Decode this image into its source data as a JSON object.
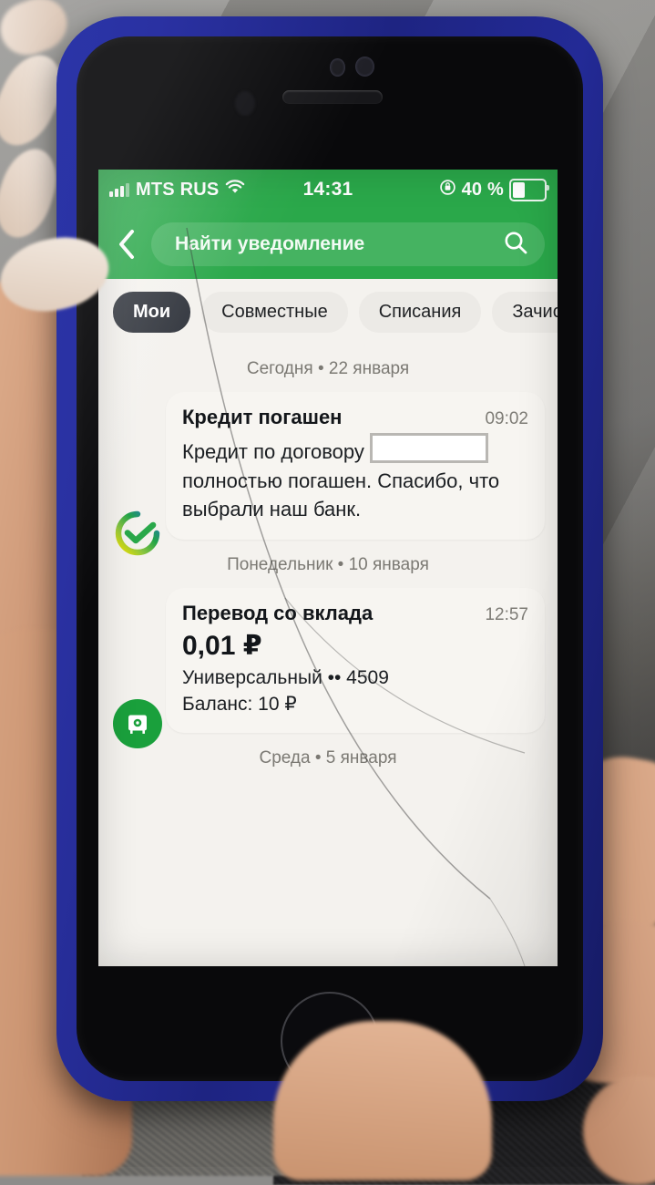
{
  "status_bar": {
    "carrier": "MTS RUS",
    "time": "14:31",
    "battery_percent": "40 %",
    "signal_icon": "signal-bars-icon",
    "wifi_icon": "wifi-icon",
    "rotation_lock_icon": "rotation-lock-icon",
    "battery_icon": "battery-icon"
  },
  "header": {
    "back_icon": "back-chevron-icon",
    "search_placeholder": "Найти уведомление",
    "search_icon": "search-icon",
    "accent_color": "#2aa84a"
  },
  "tabs": [
    {
      "label": "Мои",
      "active": true
    },
    {
      "label": "Совместные",
      "active": false
    },
    {
      "label": "Списания",
      "active": false
    },
    {
      "label": "Зачис",
      "active": false
    }
  ],
  "feed": {
    "groups": [
      {
        "day_label": "Сегодня • 22 января",
        "notification": {
          "avatar_icon": "sberbank-logo-icon",
          "title": "Кредит погашен",
          "time": "09:02",
          "body_before": "Кредит по договору",
          "body_redacted": true,
          "body_after": "полностью погашен. Спасибо, что выбрали наш банк."
        }
      },
      {
        "day_label": "Понедельник • 10 января",
        "notification": {
          "avatar_icon": "safe-deposit-icon",
          "title": "Перевод со вклада",
          "time": "12:57",
          "amount": "0,01 ₽",
          "account": "Универсальный •• 4509",
          "balance": "Баланс: 10 ₽"
        }
      },
      {
        "day_label": "Среда • 5 января"
      }
    ]
  },
  "device": {
    "case_color": "#232a96",
    "home_button_icon": "home-button-icon",
    "earpiece_icon": "earpiece-speaker-icon",
    "front_camera_icon": "front-camera-icon"
  }
}
